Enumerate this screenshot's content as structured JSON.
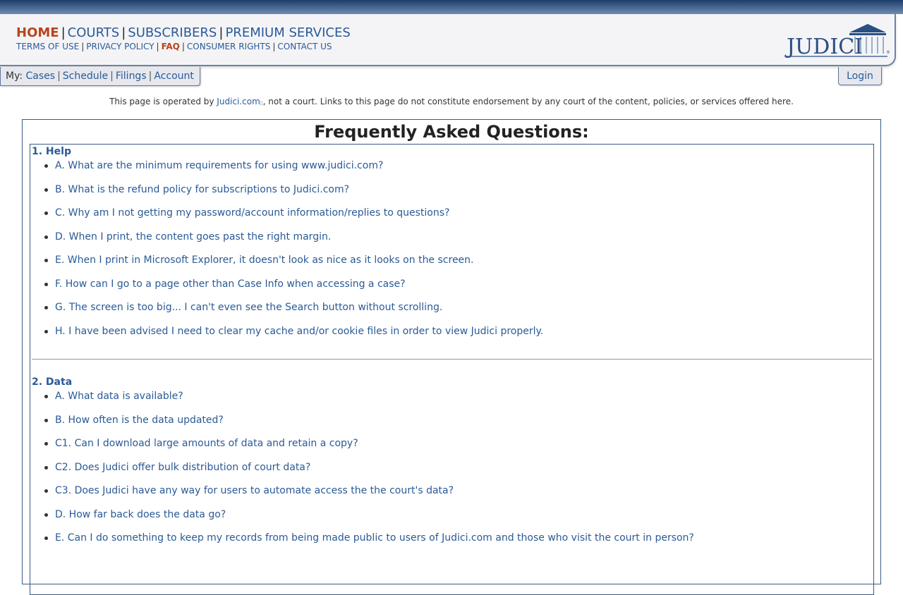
{
  "nav": {
    "main": [
      "HOME",
      "COURTS",
      "SUBSCRIBERS",
      "PREMIUM SERVICES"
    ],
    "sub": [
      "TERMS OF USE",
      "PRIVACY POLICY",
      "FAQ",
      "CONSUMER RIGHTS",
      "CONTACT US"
    ]
  },
  "logo": {
    "text": "JUDICI",
    "mark": "®"
  },
  "mybar": {
    "prefix": "My:",
    "items": [
      "Cases",
      "Schedule",
      "Filings",
      "Account"
    ]
  },
  "login_label": "Login",
  "disclaimer": {
    "before": "This page is operated by ",
    "link": "Judici.com",
    "after": ", not a court. Links to this page do not constitute endorsement by any court of the content, policies, or services offered here."
  },
  "faq": {
    "title": "Frequently Asked Questions:",
    "sections": [
      {
        "title": "1. Help",
        "questions": [
          "A. What are the minimum requirements for using www.judici.com?",
          "B. What is the refund policy for subscriptions to Judici.com?",
          "C. Why am I not getting my password/account information/replies to questions?",
          "D. When I print, the content goes past the right margin.",
          "E. When I print in Microsoft Explorer, it doesn't look as nice as it looks on the screen.",
          "F. How can I go to a page other than Case Info when accessing a case?",
          "G. The screen is too big... I can't even see the Search button without scrolling.",
          "H. I have been advised I need to clear my cache and/or cookie files in order to view Judici properly."
        ]
      },
      {
        "title": "2. Data",
        "questions": [
          "A. What data is available?",
          "B. How often is the data updated?",
          "C1. Can I download large amounts of data and retain a copy?",
          "C2. Does Judici offer bulk distribution of court data?",
          "C3. Does Judici have any way for users to automate access the the court's data?",
          "D. How far back does the data go?",
          "E. Can I do something to keep my records from being made public to users of Judici.com and those who visit the court in person?"
        ]
      }
    ]
  },
  "colors": {
    "link": "#2a5a96",
    "active": "#b8441c",
    "border": "#3a5a86"
  }
}
